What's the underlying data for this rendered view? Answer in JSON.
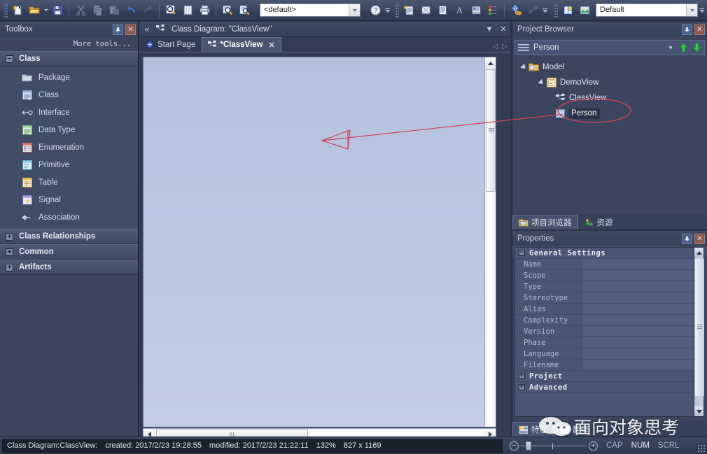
{
  "toolbars": {
    "main": {
      "buttons": [
        {
          "name": "new-file-icon",
          "title": "New"
        },
        {
          "name": "open-folder-icon",
          "title": "Open"
        },
        {
          "name": "save-icon",
          "title": "Save"
        },
        {
          "name": "cut-icon",
          "title": "Cut"
        },
        {
          "name": "copy-icon",
          "title": "Copy"
        },
        {
          "name": "paste-icon",
          "title": "Paste"
        },
        {
          "name": "undo-icon",
          "title": "Undo"
        },
        {
          "name": "redo-icon",
          "title": "Redo"
        },
        {
          "name": "zoom-search-icon",
          "title": "Find"
        },
        {
          "name": "column-view-icon",
          "title": "View"
        },
        {
          "name": "print-icon",
          "title": "Print"
        },
        {
          "name": "find-in-project-icon",
          "title": "Search Project"
        },
        {
          "name": "inspect-document-icon",
          "title": "Inspect"
        }
      ],
      "perspective_value": "<default>",
      "help_icon": "help-icon",
      "second_group": [
        {
          "name": "new-diagram-icon"
        },
        {
          "name": "matrix-icon"
        },
        {
          "name": "document-icon"
        },
        {
          "name": "font-icon"
        },
        {
          "name": "image-icon"
        },
        {
          "name": "chart-icon"
        },
        {
          "name": "link-globe-icon"
        },
        {
          "name": "trace-icon"
        }
      ],
      "third_group": [
        {
          "name": "layout-icon"
        },
        {
          "name": "picture-icon"
        }
      ],
      "workspace_value": "Default"
    }
  },
  "toolbox": {
    "title": "Toolbox",
    "more_tools": "More tools...",
    "pin_icon": "pin-icon",
    "close_icon": "close-icon",
    "categories": [
      {
        "label": "Class",
        "expanded": true,
        "toggle": "−",
        "items": [
          {
            "label": "Package",
            "icon": "package-icon"
          },
          {
            "label": "Class",
            "icon": "class-icon"
          },
          {
            "label": "Interface",
            "icon": "interface-icon"
          },
          {
            "label": "Data Type",
            "icon": "data-type-icon"
          },
          {
            "label": "Enumeration",
            "icon": "enumeration-icon"
          },
          {
            "label": "Primitive",
            "icon": "primitive-icon"
          },
          {
            "label": "Table",
            "icon": "table-icon"
          },
          {
            "label": "Signal",
            "icon": "signal-icon"
          },
          {
            "label": "Association",
            "icon": "association-icon"
          }
        ]
      },
      {
        "label": "Class Relationships",
        "expanded": false,
        "toggle": "+",
        "items": []
      },
      {
        "label": "Common",
        "expanded": false,
        "toggle": "+",
        "items": []
      },
      {
        "label": "Artifacts",
        "expanded": false,
        "toggle": "+",
        "items": []
      }
    ]
  },
  "diagram": {
    "caption": "Class Diagram: \"ClassView\"",
    "collapse_icon": "double-chevron-left-icon",
    "diagram_icon": "class-diagram-icon",
    "menu_icon": "chevron-down-icon",
    "close_icon": "close-icon",
    "tabs": [
      {
        "label": "Start Page",
        "icon": "start-page-icon",
        "active": false,
        "closable": false
      },
      {
        "label": "*ClassView",
        "icon": "class-diagram-icon",
        "active": true,
        "closable": true
      }
    ],
    "tab_nav_prev": "◁",
    "tab_nav_next": "▷"
  },
  "project_browser": {
    "title": "Project Browser",
    "pin_icon": "pin-icon",
    "close_icon": "close-icon",
    "search_value": "Person",
    "search_dropdown_icon": "chevron-down-icon",
    "up_icon": "arrow-up-icon",
    "down_icon": "arrow-down-icon",
    "tree": [
      {
        "label": "Model",
        "icon": "model-folder-icon",
        "depth": 0,
        "expanded": true,
        "selected": false
      },
      {
        "label": "DemoView",
        "icon": "view-icon",
        "depth": 1,
        "expanded": true,
        "selected": false
      },
      {
        "label": "ClassView",
        "icon": "class-diagram-icon",
        "depth": 2,
        "expanded": false,
        "selected": false
      },
      {
        "label": "Person",
        "icon": "class-icon",
        "depth": 2,
        "expanded": false,
        "selected": true
      }
    ],
    "dock_tabs": [
      {
        "label": "项目浏览器",
        "icon": "project-browser-icon",
        "active": true
      },
      {
        "label": "资源",
        "icon": "resources-icon",
        "active": false
      }
    ]
  },
  "properties": {
    "title": "Properties",
    "pin_icon": "pin-icon",
    "close_icon": "close-icon",
    "toolbar": [
      {
        "name": "categorized-icon",
        "active": true
      },
      {
        "name": "alphabetical-icon",
        "active": false
      },
      {
        "name": "apply-icon",
        "active": false
      },
      {
        "name": "tag-icon",
        "active": false
      },
      {
        "name": "notes-icon",
        "active": false
      },
      {
        "name": "up-level-icon",
        "active": false
      },
      {
        "name": "glasses-icon",
        "active": false
      }
    ],
    "groups": [
      {
        "label": "General Settings",
        "expanded": true,
        "toggle": "−",
        "rows": [
          {
            "key": "Name",
            "value": ""
          },
          {
            "key": "Scope",
            "value": ""
          },
          {
            "key": "Type",
            "value": ""
          },
          {
            "key": "Stereotype",
            "value": ""
          },
          {
            "key": "Alias",
            "value": ""
          },
          {
            "key": "Complexity",
            "value": ""
          },
          {
            "key": "Version",
            "value": ""
          },
          {
            "key": "Phase",
            "value": ""
          },
          {
            "key": "Language",
            "value": ""
          },
          {
            "key": "Filename",
            "value": ""
          }
        ]
      },
      {
        "label": "Project",
        "expanded": false,
        "toggle": "+",
        "rows": []
      },
      {
        "label": "Advanced",
        "expanded": false,
        "toggle": "+",
        "rows": []
      }
    ],
    "dock_tabs": [
      {
        "label": "特性",
        "icon": "properties-icon",
        "active": true
      },
      {
        "label": "翻译",
        "icon": "translate-icon",
        "active": false
      }
    ]
  },
  "statusbar": {
    "context": "Class Diagram:ClassView:",
    "created_label": "created: 2017/2/23 19:28:55",
    "modified_label": "modified: 2017/2/23 21:22:11",
    "zoom_percent": "132%",
    "page_size": "827 x 1169",
    "zoom_out_icon": "zoom-out-icon",
    "zoom_in_icon": "zoom-in-icon",
    "flags": [
      {
        "label": "CAP",
        "active": false
      },
      {
        "label": "NUM",
        "active": true
      },
      {
        "label": "SCRL",
        "active": false
      }
    ]
  },
  "annotation": {
    "color": "#d0405a",
    "ellipse_label": "Person",
    "arrow_name": "red-annotation-arrow"
  },
  "watermark": {
    "text": "面向对象思考",
    "logo": "wechat-logo"
  }
}
